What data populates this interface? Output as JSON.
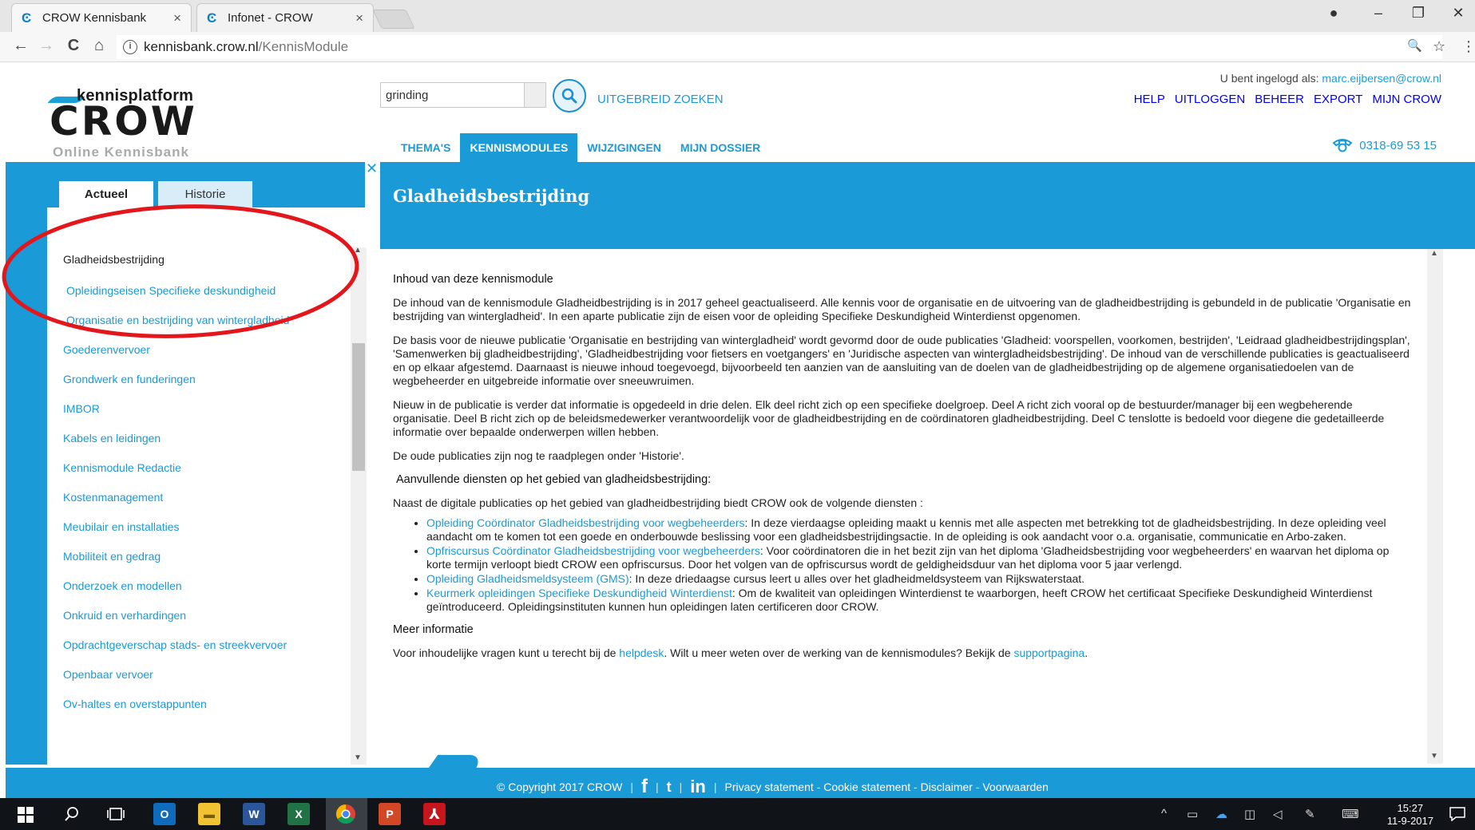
{
  "browser": {
    "tabs": [
      {
        "title": "CROW Kennisbank",
        "favicon": "crow-c-icon",
        "close": "×"
      },
      {
        "title": "Infonet - CROW",
        "favicon": "crow-c-icon",
        "close": "×"
      }
    ],
    "window_controls": {
      "profile": "●",
      "minimize": "–",
      "restore": "❐",
      "close": "✕"
    },
    "nav": {
      "back": "←",
      "forward": "→",
      "reload": "C",
      "home": "⌂"
    },
    "url_host": "kennisbank.crow.nl",
    "url_path": "/KennisModule",
    "omnibox_icons": {
      "zoom": "🔍",
      "star": "☆",
      "menu": "⋮"
    }
  },
  "header": {
    "login_prefix": "U bent ingelogd als: ",
    "login_email": "marc.eijbersen@crow.nl",
    "logo_top": "kennisplatform",
    "logo_main": "CROW",
    "logo_sub": "Online Kennisbank",
    "search_value": "grinding",
    "advanced_search": "UITGEBREID ZOEKEN",
    "top_links": [
      "HELP",
      "UITLOGGEN",
      "BEHEER",
      "EXPORT",
      "MIJN CROW"
    ],
    "phone": "0318-69 53 15",
    "main_nav": [
      "THEMA'S",
      "KENNISMODULES",
      "WIJZIGINGEN",
      "MIJN DOSSIER"
    ]
  },
  "sidebar": {
    "close": "✕",
    "tabs": [
      "Actueel",
      "Historie"
    ],
    "current": "Gladheidsbestrijding",
    "sub_items": [
      "Opleidingseisen Specifieke deskundigheid",
      "Organisatie en bestrijding van wintergladheid"
    ],
    "items": [
      "Goederenvervoer",
      "Grondwerk en funderingen",
      "IMBOR",
      "Kabels en leidingen",
      "Kennismodule Redactie",
      "Kostenmanagement",
      "Meubilair en installaties",
      "Mobiliteit en gedrag",
      "Onderzoek en modellen",
      "Onkruid en verhardingen",
      "Opdrachtgeverschap stads- en streekvervoer",
      "Openbaar vervoer",
      "Ov-haltes en overstappunten"
    ]
  },
  "content": {
    "title": "Gladheidsbestrijding",
    "section1_heading": "Inhoud van deze kennismodule",
    "p1": "De inhoud van de kennismodule Gladheidbestrijding is in 2017 geheel geactualiseerd. Alle kennis voor de organisatie en de uitvoering van de gladheidbestrijding is gebundeld in de publicatie 'Organisatie en bestrijding van wintergladheid'. In een aparte publicatie zijn de eisen voor de opleiding Specifieke Deskundigheid Winterdienst opgenomen.",
    "p2": "De basis voor de nieuwe publicatie 'Organisatie en bestrijding van wintergladheid' wordt gevormd door de oude publicaties 'Gladheid: voorspellen, voorkomen, bestrijden', 'Leidraad gladheidbestrijdingsplan', 'Samenwerken bij gladheidbestrijding', 'Gladheidbestrijding voor fietsers en voetgangers' en 'Juridische aspecten van wintergladheidsbestrijding'. De inhoud van de verschillende publicaties is geactualiseerd en op elkaar afgestemd. Daarnaast is nieuwe inhoud toegevoegd, bijvoorbeeld ten aanzien van de aansluiting van de doelen van de gladheidbestrijding op de algemene organisatiedoelen van de wegbeheerder en uitgebreide informatie over sneeuwruimen.",
    "p3": "Nieuw in de publicatie is verder dat informatie is opgedeeld in drie delen. Elk deel richt zich op een specifieke doelgroep. Deel A richt zich vooral op de bestuurder/manager bij een wegbeherende organisatie. Deel B richt zich op de beleidsmedewerker verantwoordelijk voor de gladheidbestrijding en de coördinatoren gladheidbestrijding. Deel C tenslotte is bedoeld voor diegene die gedetailleerde informatie over bepaalde onderwerpen willen hebben.",
    "p4": "De oude publicaties zijn nog te raadplegen onder 'Historie'.",
    "section2_heading": "Aanvullende diensten op het gebied van gladheidsbestrijding:",
    "p5": "Naast de digitale publicaties op het gebied van gladheidbestrijding biedt CROW ook de volgende diensten :",
    "services": [
      {
        "link": "Opleiding Coördinator Gladheidsbestrijding voor wegbeheerders",
        "text": ": In deze vierdaagse opleiding maakt u kennis met alle aspecten met betrekking tot de gladheidsbestrijding. In deze opleiding veel aandacht om te komen tot een goede en onderbouwde beslissing voor een gladheidsbestrijdingsactie. In de opleiding is ook aandacht voor o.a. organisatie, communicatie en Arbo-zaken."
      },
      {
        "link": "Opfriscursus Coördinator Gladheidsbestrijding voor wegbeheerders",
        "text": ": Voor coördinatoren die in het bezit zijn van het diploma 'Gladheidsbestrijding voor wegbeheerders' en waarvan het diploma op korte termijn verloopt biedt CROW een opfriscursus. Door het volgen van de opfriscursus wordt de geldigheidsduur van het diploma voor 5 jaar verlengd."
      },
      {
        "link": "Opleiding Gladheidsmeldsysteem (GMS)",
        "text": ": In deze driedaagse cursus leert u alles over het gladheidmeldsysteem van Rijkswaterstaat."
      },
      {
        "link": "Keurmerk opleidingen Specifieke Deskundigheid Winterdienst",
        "text": ": Om de kwaliteit van opleidingen Winterdienst te waarborgen, heeft CROW het certificaat Specifieke Deskundigheid Winterdienst geïntroduceerd. Opleidingsinstituten kunnen hun opleidingen laten certificeren door CROW."
      }
    ],
    "section3_heading": "Meer informatie",
    "p6_a": "Voor inhoudelijke vragen kunt u terecht bij de ",
    "p6_link1": "helpdesk",
    "p6_b": ". Wilt u meer weten over de werking van de kennismodules? Bekijk de ",
    "p6_link2": "supportpagina",
    "p6_c": "."
  },
  "footer": {
    "copyright": "© Copyright 2017 CROW",
    "social": [
      "f",
      "t",
      "in"
    ],
    "links": "Privacy statement - Cookie statement - Disclaimer - Voorwaarden"
  },
  "taskbar": {
    "apps": [
      "O",
      "W",
      "X",
      "P"
    ],
    "time": "15:27",
    "date": "11-9-2017"
  },
  "colors": {
    "brand_blue": "#1a9ad6",
    "annotation_red": "#e3161b"
  }
}
